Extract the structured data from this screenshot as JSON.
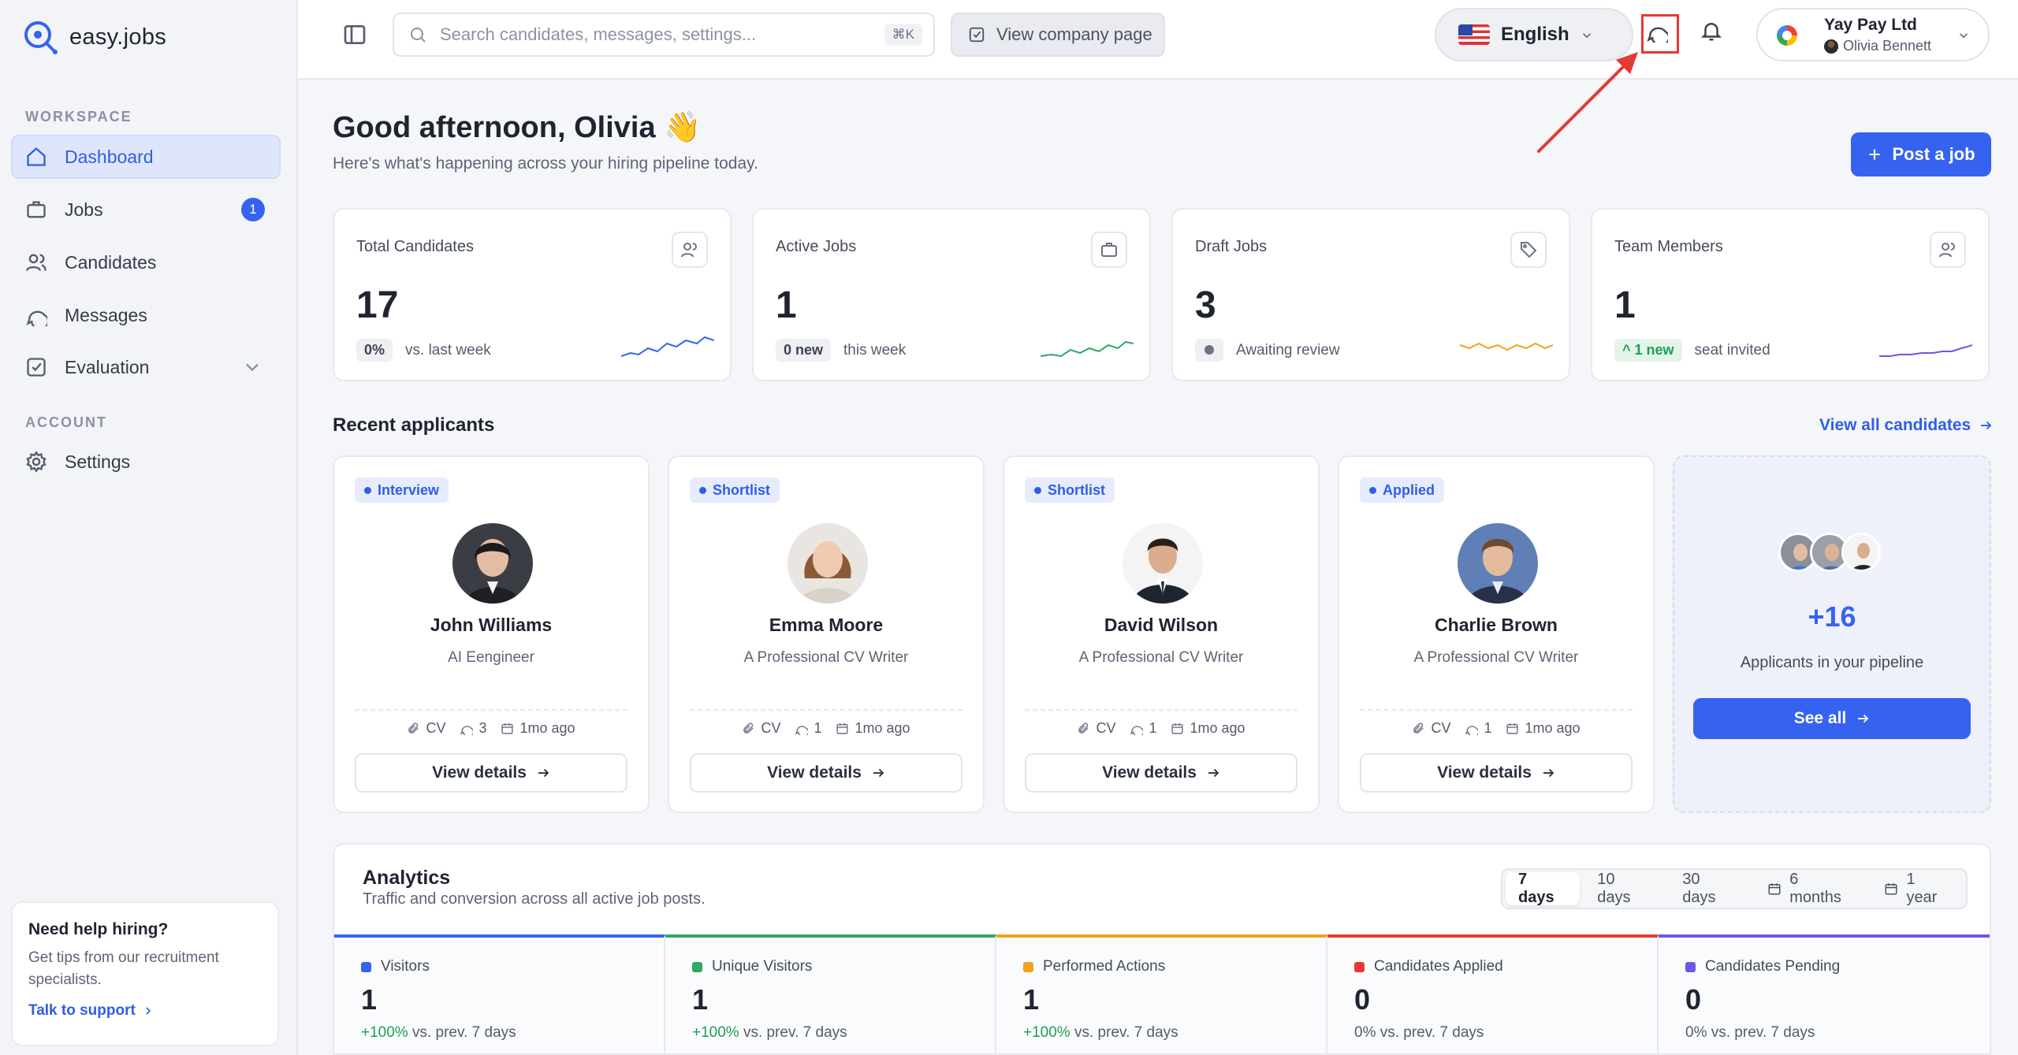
{
  "app": {
    "name": "easy.jobs"
  },
  "sidebar": {
    "workspace_label": "WORKSPACE",
    "account_label": "ACCOUNT",
    "items": [
      {
        "label": "Dashboard",
        "icon": "home-icon",
        "active": true
      },
      {
        "label": "Jobs",
        "icon": "briefcase-icon",
        "badge": "1"
      },
      {
        "label": "Candidates",
        "icon": "users-icon"
      },
      {
        "label": "Messages",
        "icon": "chat-icon"
      },
      {
        "label": "Evaluation",
        "icon": "checkbox-icon",
        "has_chevron": true
      }
    ],
    "settings": {
      "label": "Settings",
      "icon": "gear-icon"
    },
    "help": {
      "title": "Need help hiring?",
      "description": "Get tips from our recruitment specialists.",
      "link": "Talk to support"
    }
  },
  "topbar": {
    "search_placeholder": "Search candidates, messages, settings...",
    "search_shortcut": "⌘K",
    "company_page_label": "View company page",
    "language": "English",
    "company": "Yay Pay Ltd",
    "user": "Olivia Bennett"
  },
  "header": {
    "greeting": "Good afternoon, Olivia 👋",
    "subtitle": "Here's what's happening across your hiring pipeline today.",
    "post_job_label": "Post a job"
  },
  "stats": [
    {
      "label": "Total Candidates",
      "value": "17",
      "pill": "0%",
      "foot": "vs. last week",
      "icon": "users-icon",
      "spark_color": "#3563f0"
    },
    {
      "label": "Active Jobs",
      "value": "1",
      "pill": "0 new",
      "foot": "this week",
      "icon": "briefcase-icon",
      "spark_color": "#2fa86a"
    },
    {
      "label": "Draft Jobs",
      "value": "3",
      "pill": "",
      "foot": "Awaiting review",
      "icon": "tag-icon",
      "spark_color": "#f0a21e"
    },
    {
      "label": "Team Members",
      "value": "1",
      "pill": "^ 1 new",
      "foot": "seat invited",
      "icon": "users-icon",
      "spark_color": "#6a58e6"
    }
  ],
  "recent": {
    "title": "Recent applicants",
    "view_all": "View all candidates",
    "applicants": [
      {
        "status": "Interview",
        "name": "John Williams",
        "role": "AI Eengineer",
        "cv": "CV",
        "comments": "3",
        "time": "1mo ago",
        "button": "View details"
      },
      {
        "status": "Shortlist",
        "name": "Emma Moore",
        "role": "A Professional CV Writer",
        "cv": "CV",
        "comments": "1",
        "time": "1mo ago",
        "button": "View details"
      },
      {
        "status": "Shortlist",
        "name": "David Wilson",
        "role": "A Professional CV Writer",
        "cv": "CV",
        "comments": "1",
        "time": "1mo ago",
        "button": "View details"
      },
      {
        "status": "Applied",
        "name": "Charlie Brown",
        "role": "A Professional CV Writer",
        "cv": "CV",
        "comments": "1",
        "time": "1mo ago",
        "button": "View details"
      }
    ],
    "more": {
      "count": "+16",
      "label": "Applicants in your pipeline",
      "button": "See all"
    }
  },
  "analytics": {
    "title": "Analytics",
    "subtitle": "Traffic and conversion across all active job posts.",
    "ranges": [
      "7 days",
      "10 days",
      "30 days",
      "6 months",
      "1 year"
    ],
    "active_range": "7 days",
    "metrics": [
      {
        "label": "Visitors",
        "value": "1",
        "change": "+100%",
        "foot": "vs. prev. 7 days",
        "color": "#3563f0"
      },
      {
        "label": "Unique Visitors",
        "value": "1",
        "change": "+100%",
        "foot": "vs. prev. 7 days",
        "color": "#2fa86a"
      },
      {
        "label": "Performed Actions",
        "value": "1",
        "change": "+100%",
        "foot": "vs. prev. 7 days",
        "color": "#f0a21e"
      },
      {
        "label": "Candidates Applied",
        "value": "0",
        "change": "0%",
        "foot": "vs. prev. 7 days",
        "color": "#e53935"
      },
      {
        "label": "Candidates Pending",
        "value": "0",
        "change": "0%",
        "foot": "vs. prev. 7 days",
        "color": "#6a58e6"
      }
    ]
  }
}
